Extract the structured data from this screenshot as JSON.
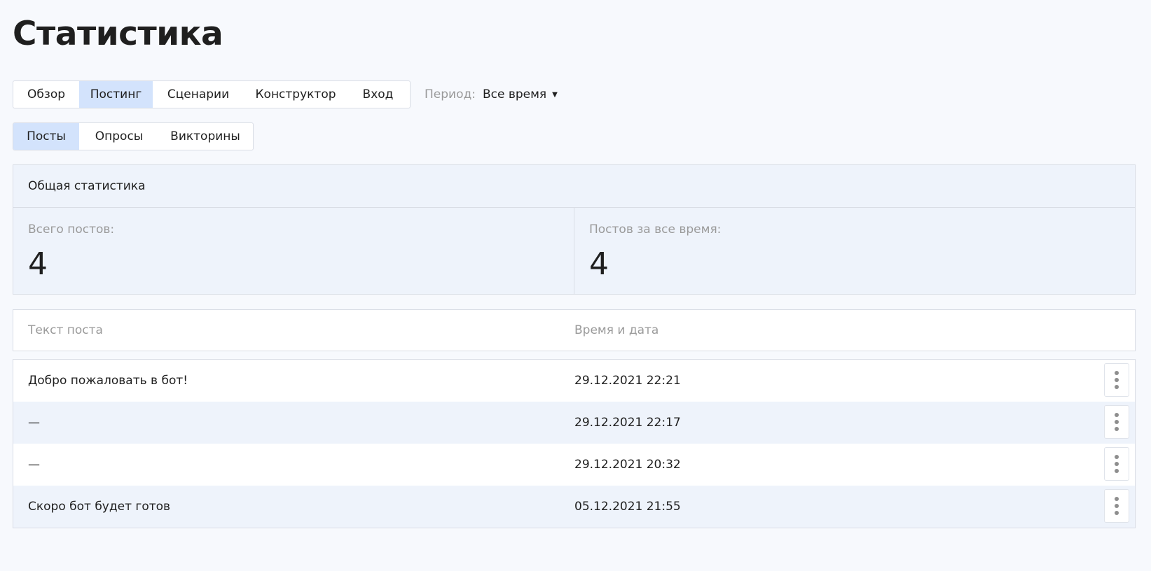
{
  "page": {
    "title": "Статистика"
  },
  "main_tabs": [
    {
      "label": "Обзор",
      "active": false
    },
    {
      "label": "Постинг",
      "active": true
    },
    {
      "label": "Сценарии",
      "active": false
    },
    {
      "label": "Конструктор",
      "active": false
    },
    {
      "label": "Вход",
      "active": false
    }
  ],
  "period": {
    "label": "Период:",
    "value": "Все время",
    "icon": "caret-down-icon"
  },
  "sub_tabs": [
    {
      "label": "Посты",
      "active": true
    },
    {
      "label": "Опросы",
      "active": false
    },
    {
      "label": "Викторины",
      "active": false
    }
  ],
  "summary": {
    "header": "Общая статистика",
    "total_label": "Всего постов:",
    "total_value": "4",
    "alltime_label": "Постов за все время:",
    "alltime_value": "4"
  },
  "table": {
    "col_text": "Текст поста",
    "col_time": "Время и дата",
    "rows": [
      {
        "text": "Добро пожаловать в бот!",
        "time": "29.12.2021 22:21"
      },
      {
        "text": "—",
        "time": "29.12.2021 22:17"
      },
      {
        "text": "—",
        "time": "29.12.2021 20:32"
      },
      {
        "text": "Скоро бот будет готов",
        "time": "05.12.2021 21:55"
      }
    ],
    "row_menu_icon": "more-vertical-icon"
  },
  "colors": {
    "background": "#f7f9fd",
    "active_tab": "#d3e3fc",
    "striped_row": "#eef3fb",
    "muted_text": "#9a9a9a",
    "border": "#d9dde5"
  }
}
